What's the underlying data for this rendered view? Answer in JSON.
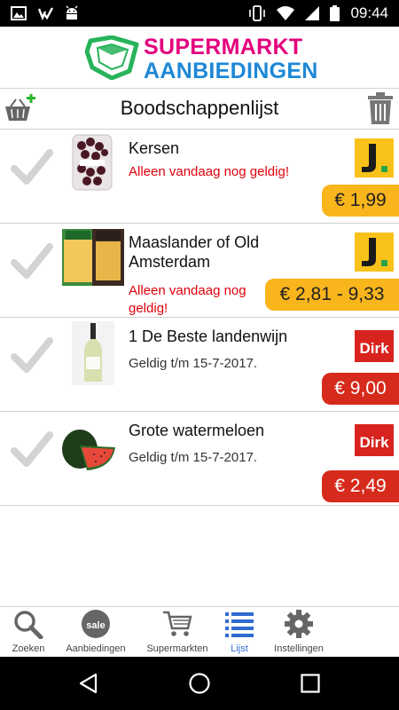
{
  "status_bar": {
    "time": "09:44"
  },
  "app": {
    "logo_line1": "SUPERMARKT",
    "logo_line2": "AANBIEDINGEN"
  },
  "header": {
    "title": "Boodschappenlijst"
  },
  "items": [
    {
      "name": "Kersen",
      "note": "Alleen vandaag nog geldig!",
      "price": "€ 1,99",
      "store": "Jumbo"
    },
    {
      "name": "Maaslander of Old Amsterdam",
      "note": "Alleen vandaag nog geldig!",
      "price": "€ 2,81 - 9,33",
      "store": "Jumbo",
      "thumb_text_1": "MAAS LANDER",
      "thumb_text_2": "Old Amsterdam"
    },
    {
      "name": "1 De Beste landenwijn",
      "note": "Geldig t/m 15-7-2017.",
      "price": "€ 9,00",
      "store": "Dirk"
    },
    {
      "name": "Grote watermeloen",
      "note": "Geldig t/m 15-7-2017.",
      "price": "€ 2,49",
      "store": "Dirk"
    }
  ],
  "stores": {
    "dirk_logo_text": "Dirk",
    "jumbo_logo_text": "J"
  },
  "nav": {
    "items": [
      {
        "label": "Zoeken",
        "icon": "search-icon"
      },
      {
        "label": "Aanbiedingen",
        "icon": "sale-tag-icon",
        "badge": "sale"
      },
      {
        "label": "Supermarkten",
        "icon": "cart-icon"
      },
      {
        "label": "Lijst",
        "icon": "list-icon",
        "active": true
      },
      {
        "label": "Instellingen",
        "icon": "gear-icon"
      }
    ]
  },
  "colors": {
    "magenta": "#e4007d",
    "blue": "#1e88d6",
    "jumbo_yellow": "#f9b51c",
    "dirk_red": "#d62a1c",
    "alert_red": "#e0000b",
    "active_blue": "#2f6bd0"
  }
}
